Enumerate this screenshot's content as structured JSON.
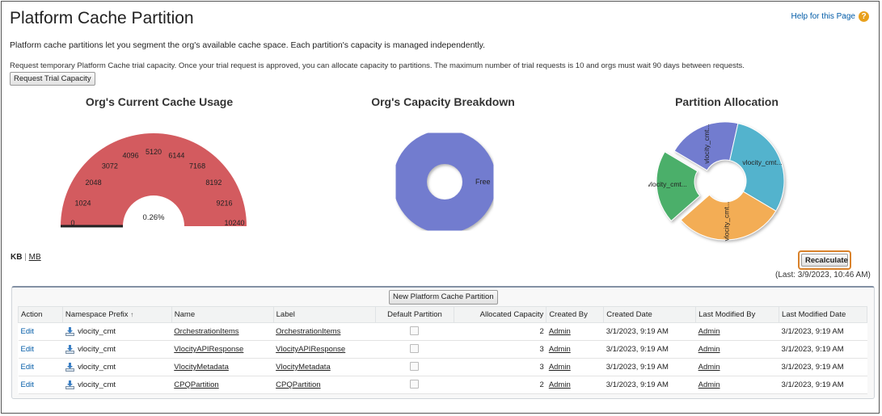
{
  "page": {
    "title": "Platform Cache Partition",
    "help_link": "Help for this Page",
    "description": "Platform cache partitions let you segment the org's available cache space. Each partition's capacity is managed independently.",
    "trial_note": "Request temporary Platform Cache trial capacity. Once your trial request is approved, you can allocate capacity to partitions. The maximum number of trial requests is 10 and orgs must wait 90 days between requests.",
    "trial_button": "Request Trial Capacity"
  },
  "charts": {
    "usage_title": "Org's Current Cache Usage",
    "breakdown_title": "Org's Capacity Breakdown",
    "allocation_title": "Partition Allocation"
  },
  "chart_data": [
    {
      "type": "gauge",
      "title": "Org's Current Cache Usage",
      "min": 0,
      "max": 10240,
      "ticks": [
        "0",
        "1024",
        "2048",
        "3072",
        "4096",
        "5120",
        "6144",
        "7168",
        "8192",
        "9216",
        "10240"
      ],
      "value_label": "0.26%",
      "value_percent": 0.26
    },
    {
      "type": "pie",
      "title": "Org's Capacity Breakdown",
      "labels": [
        "Free"
      ],
      "values": [
        100
      ]
    },
    {
      "type": "pie",
      "title": "Partition Allocation",
      "labels": [
        "vlocity_cmt...",
        "vlocity_cmt...",
        "vlocity_cmt...",
        "vlocity_cmt..."
      ],
      "values": [
        2,
        3,
        3,
        2
      ]
    }
  ],
  "units": {
    "kb": "KB",
    "separator": "|",
    "mb": "MB"
  },
  "recalculate_button": "Recalculate",
  "last_calculated": "(Last: 3/9/2023, 10:46 AM)",
  "new_partition_button": "New Platform Cache Partition",
  "colors": {
    "gauge": "#d35b5f",
    "free": "#727ccf",
    "alloc": [
      "#727ccf",
      "#52b3cd",
      "#f3ad54",
      "#4caf6a"
    ]
  },
  "table": {
    "headers": [
      "Action",
      "Namespace Prefix",
      "Name",
      "Label",
      "Default Partition",
      "Allocated Capacity",
      "Created By",
      "Created Date",
      "Last Modified By",
      "Last Modified Date"
    ],
    "sort_indicator": "↑",
    "rows": [
      {
        "action": "Edit",
        "namespace": "vlocity_cmt",
        "name": "OrchestrationItems",
        "label": "OrchestrationItems",
        "capacity": "2",
        "created_by": "Admin",
        "created_date": "3/1/2023, 9:19 AM",
        "modified_by": "Admin",
        "modified_date": "3/1/2023, 9:19 AM"
      },
      {
        "action": "Edit",
        "namespace": "vlocity_cmt",
        "name": "VlocityAPIResponse",
        "label": "VlocityAPIResponse",
        "capacity": "3",
        "created_by": "Admin",
        "created_date": "3/1/2023, 9:19 AM",
        "modified_by": "Admin",
        "modified_date": "3/1/2023, 9:19 AM"
      },
      {
        "action": "Edit",
        "namespace": "vlocity_cmt",
        "name": "VlocityMetadata",
        "label": "VlocityMetadata",
        "capacity": "3",
        "created_by": "Admin",
        "created_date": "3/1/2023, 9:19 AM",
        "modified_by": "Admin",
        "modified_date": "3/1/2023, 9:19 AM"
      },
      {
        "action": "Edit",
        "namespace": "vlocity_cmt",
        "name": "CPQPartition",
        "label": "CPQPartition",
        "capacity": "2",
        "created_by": "Admin",
        "created_date": "3/1/2023, 9:19 AM",
        "modified_by": "Admin",
        "modified_date": "3/1/2023, 9:19 AM"
      }
    ]
  }
}
